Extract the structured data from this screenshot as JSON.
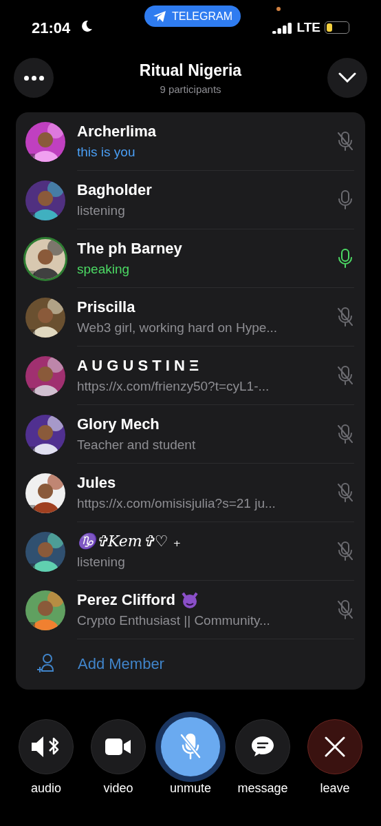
{
  "status_bar": {
    "time": "21:04",
    "app_pill": "TELEGRAM",
    "network": "LTE"
  },
  "header": {
    "title": "Ritual Nigeria",
    "subtitle": "9 participants"
  },
  "participants": [
    {
      "name": "Archerlima",
      "status": "this is you",
      "kind": "self",
      "muted": true
    },
    {
      "name": "Bagholder",
      "status": "listening",
      "kind": "listening",
      "muted": false
    },
    {
      "name": "The ph Barney",
      "status": "speaking",
      "kind": "speaking",
      "muted": false
    },
    {
      "name": "Priscilla",
      "status": "Web3 girl, working hard on Hype...",
      "kind": "bio",
      "muted": true
    },
    {
      "name": "A U G U S T I N Ξ",
      "status": "https://x.com/frienzy50?t=cyL1-...",
      "kind": "bio",
      "muted": true
    },
    {
      "name": "Glory Mech",
      "status": "Teacher and student",
      "kind": "bio",
      "muted": true
    },
    {
      "name": "Jules",
      "status": "https://x.com/omisisjulia?s=21 ju...",
      "kind": "bio",
      "muted": true
    },
    {
      "name": "♑✞Kem✞♡ ₊",
      "status": "listening",
      "kind": "listening",
      "muted": true
    },
    {
      "name": "Perez Clifford",
      "emoji": true,
      "status": "Crypto Enthusiast || Community...",
      "kind": "bio",
      "muted": true
    }
  ],
  "add_member": "Add Member",
  "controls": [
    {
      "label": "audio",
      "kind": "audio"
    },
    {
      "label": "video",
      "kind": "video"
    },
    {
      "label": "unmute",
      "kind": "unmute"
    },
    {
      "label": "message",
      "kind": "message"
    },
    {
      "label": "leave",
      "kind": "leave"
    }
  ]
}
